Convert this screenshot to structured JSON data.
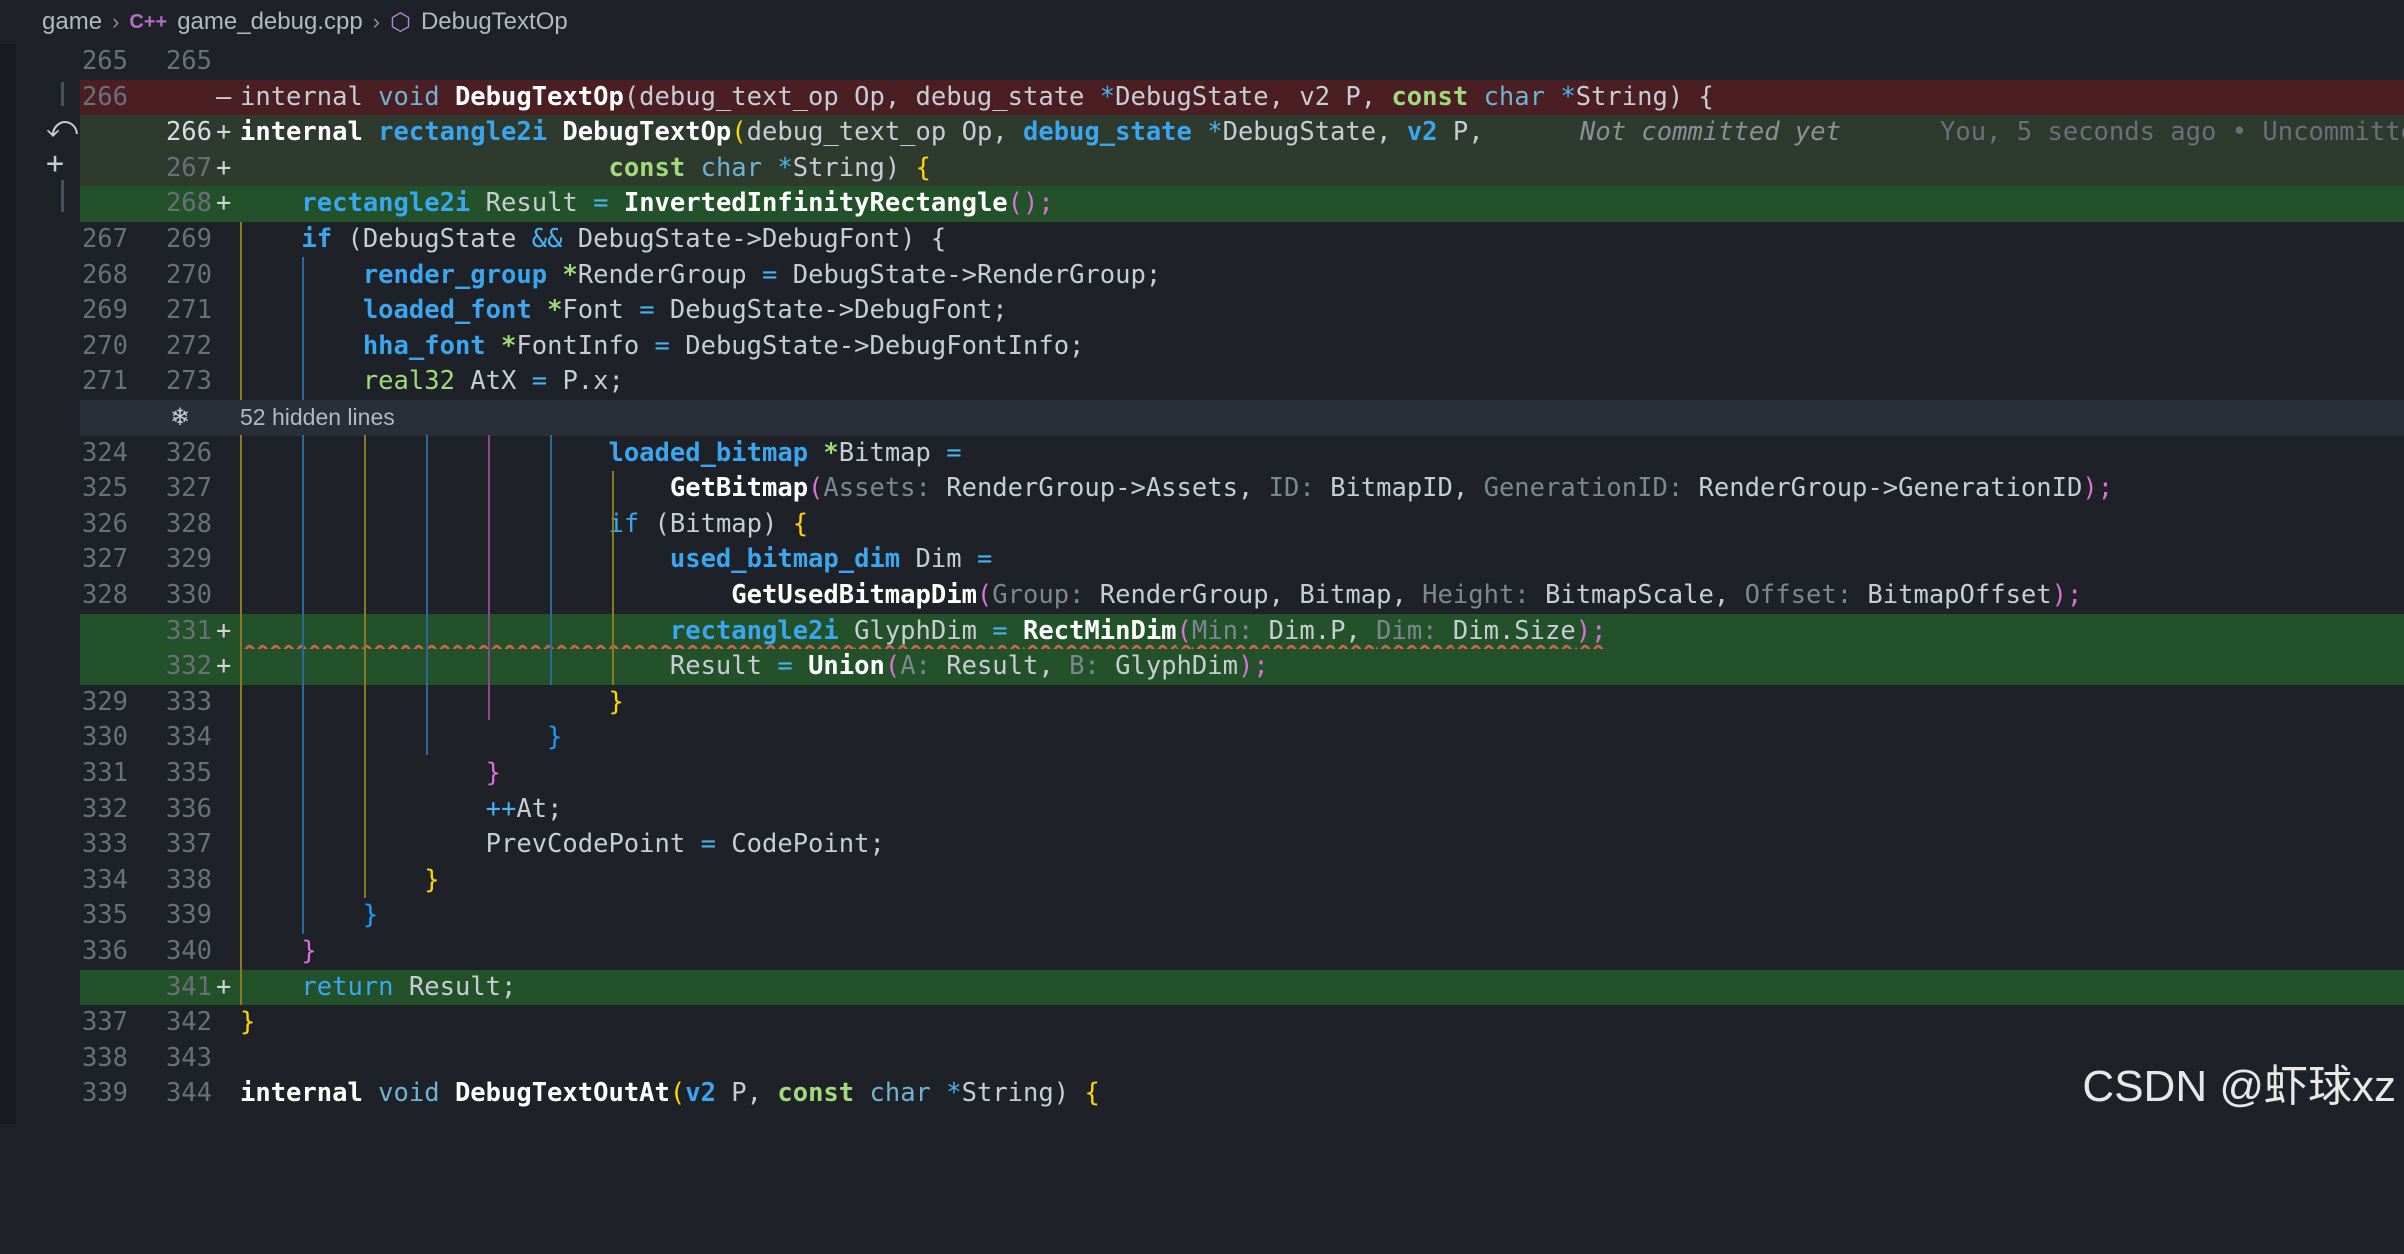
{
  "breadcrumb": {
    "folder": "game",
    "file": "game_debug.cpp",
    "symbol": "DebugTextOp",
    "file_icon": "C++-icon",
    "symbol_icon": "cube-icon"
  },
  "hidden_lines": "52 hidden lines",
  "blame": {
    "status": "Not committed yet",
    "author": "You, 5 seconds ago • Uncommitted"
  },
  "lines": [
    {
      "old": "265",
      "new": "265",
      "mark": ""
    },
    {
      "old": "266",
      "new": "",
      "mark": "—"
    },
    {
      "old": "",
      "new": "266",
      "mark": "+"
    },
    {
      "old": "",
      "new": "267",
      "mark": "+"
    },
    {
      "old": "",
      "new": "268",
      "mark": "+"
    },
    {
      "old": "267",
      "new": "269",
      "mark": ""
    },
    {
      "old": "268",
      "new": "270",
      "mark": ""
    },
    {
      "old": "269",
      "new": "271",
      "mark": ""
    },
    {
      "old": "270",
      "new": "272",
      "mark": ""
    },
    {
      "old": "271",
      "new": "273",
      "mark": ""
    },
    {
      "old": "324",
      "new": "326",
      "mark": ""
    },
    {
      "old": "325",
      "new": "327",
      "mark": ""
    },
    {
      "old": "326",
      "new": "328",
      "mark": ""
    },
    {
      "old": "327",
      "new": "329",
      "mark": ""
    },
    {
      "old": "328",
      "new": "330",
      "mark": ""
    },
    {
      "old": "",
      "new": "331",
      "mark": "+"
    },
    {
      "old": "",
      "new": "332",
      "mark": "+"
    },
    {
      "old": "329",
      "new": "333",
      "mark": ""
    },
    {
      "old": "330",
      "new": "334",
      "mark": ""
    },
    {
      "old": "331",
      "new": "335",
      "mark": ""
    },
    {
      "old": "332",
      "new": "336",
      "mark": ""
    },
    {
      "old": "333",
      "new": "337",
      "mark": ""
    },
    {
      "old": "334",
      "new": "338",
      "mark": ""
    },
    {
      "old": "335",
      "new": "339",
      "mark": ""
    },
    {
      "old": "336",
      "new": "340",
      "mark": ""
    },
    {
      "old": "",
      "new": "341",
      "mark": "+"
    },
    {
      "old": "337",
      "new": "342",
      "mark": ""
    },
    {
      "old": "338",
      "new": "343",
      "mark": ""
    },
    {
      "old": "339",
      "new": "344",
      "mark": ""
    }
  ],
  "code": {
    "l265": "",
    "l266_del": {
      "a": "internal ",
      "b": "void ",
      "c": "DebugTextOp",
      "d": "(debug_text_op Op, debug_state ",
      "e": "*",
      "f": "DebugState, v2 P, ",
      "g": "const ",
      "h": "char ",
      "i": "*",
      "j": "String) {"
    },
    "l266_add": {
      "a": "internal ",
      "b": "rectangle2i ",
      "c": "DebugTextOp",
      "d": "(",
      "e": "debug_text_op Op, ",
      "f": "debug_state ",
      "g": "*",
      "h": "DebugState, ",
      "i": "v2 ",
      "j": "P,"
    },
    "l267_add": {
      "a": "                        ",
      "b": "const ",
      "c": "char ",
      "d": "*",
      "e": "String) ",
      "f": "{"
    },
    "l268_add": {
      "a": "    ",
      "b": "rectangle2i ",
      "c": "Result ",
      "d": "= ",
      "e": "InvertedInfinityRectangle",
      "f": "();"
    },
    "l269": {
      "a": "    ",
      "b": "if ",
      "c": "(DebugState ",
      "d": "&& ",
      "e": "DebugState->DebugFont) {"
    },
    "l270": {
      "a": "        ",
      "b": "render_group ",
      "c": "*",
      "d": "RenderGroup ",
      "e": "= ",
      "f": "DebugState->RenderGroup;"
    },
    "l271": {
      "a": "        ",
      "b": "loaded_font ",
      "c": "*",
      "d": "Font ",
      "e": "= ",
      "f": "DebugState->DebugFont;"
    },
    "l272": {
      "a": "        ",
      "b": "hha_font ",
      "c": "*",
      "d": "FontInfo ",
      "e": "= ",
      "f": "DebugState->DebugFontInfo;"
    },
    "l273": {
      "a": "        ",
      "b": "real32 ",
      "c": "AtX ",
      "d": "= ",
      "e": "P.x;"
    },
    "l326": {
      "a": "                        ",
      "b": "loaded_bitmap ",
      "c": "*",
      "d": "Bitmap ",
      "e": "="
    },
    "l327": {
      "a": "                            ",
      "b": "GetBitmap",
      "c": "(",
      "d": "Assets: ",
      "e": "RenderGroup->Assets, ",
      "f": "ID: ",
      "g": "BitmapID, ",
      "h": "GenerationID: ",
      "i": "RenderGroup->GenerationID",
      "j": ");"
    },
    "l328": {
      "a": "                        ",
      "b": "if ",
      "c": "(Bitmap) ",
      "d": "{"
    },
    "l329": {
      "a": "                            ",
      "b": "used_bitmap_dim ",
      "c": "Dim ",
      "d": "="
    },
    "l330": {
      "a": "                                ",
      "b": "GetUsedBitmapDim",
      "c": "(",
      "d": "Group: ",
      "e": "RenderGroup, Bitmap, ",
      "f": "Height: ",
      "g": "BitmapScale, ",
      "h": "Offset: ",
      "i": "BitmapOffset",
      "j": ");"
    },
    "l331": {
      "a": "                            ",
      "b": "rectangle2i ",
      "c": "GlyphDim ",
      "d": "= ",
      "e": "RectMinDim",
      "f": "(",
      "g": "Min: ",
      "h": "Dim.P, ",
      "i": "Dim: ",
      "j": "Dim.Size",
      "k": ");"
    },
    "l332": {
      "a": "                            ",
      "b": "Result ",
      "c": "= ",
      "d": "Union",
      "e": "(",
      "f": "A: ",
      "g": "Result, ",
      "h": "B: ",
      "i": "GlyphDim",
      "j": ");"
    },
    "l333": {
      "a": "                        ",
      "b": "}"
    },
    "l334": {
      "a": "                    ",
      "b": "}"
    },
    "l335": {
      "a": "                ",
      "b": "}"
    },
    "l336": {
      "a": "                ",
      "b": "++",
      "c": "At;"
    },
    "l337": {
      "a": "                ",
      "b": "PrevCodePoint ",
      "c": "= ",
      "d": "CodePoint;"
    },
    "l338": {
      "a": "            ",
      "b": "}"
    },
    "l339": {
      "a": "        ",
      "b": "}"
    },
    "l340": {
      "a": "    ",
      "b": "}"
    },
    "l341": {
      "a": "    ",
      "b": "return ",
      "c": "Result;"
    },
    "l342": {
      "a": "}"
    },
    "l343": "",
    "l344": {
      "a": "internal ",
      "b": "void ",
      "c": "DebugTextOutAt",
      "d": "(",
      "e": "v2 ",
      "f": "P, ",
      "g": "const ",
      "h": "char ",
      "i": "*",
      "j": "String) ",
      "k": "{"
    }
  },
  "watermark": "CSDN @虾球xz",
  "colors": {
    "deleted_bg": "#4a1e22",
    "added_bg": "#23522a",
    "editor_bg": "#1e2127",
    "type": "#3aa6f0",
    "keyword": "#9fdb7a",
    "bracket_yellow": "#ffd700",
    "bracket_pink": "#da70d6",
    "bracket_blue": "#179fff"
  }
}
